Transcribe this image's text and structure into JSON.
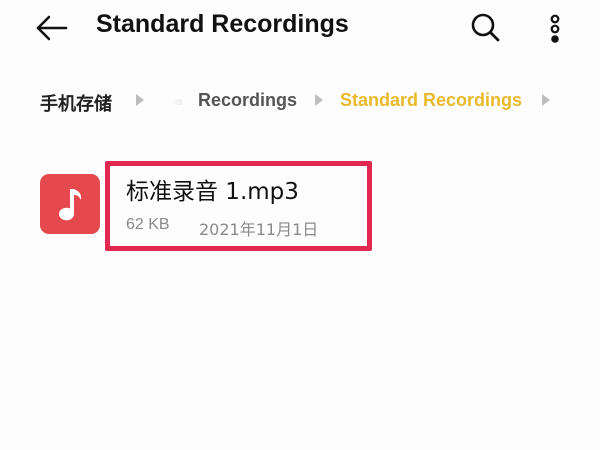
{
  "header": {
    "title": "Standard Recordings",
    "back_icon": "arrow-left-icon",
    "search_icon": "search-icon",
    "more_icon": "more-vertical-icon"
  },
  "breadcrumb": {
    "items": [
      {
        "label": "手机存储"
      },
      {
        "label": "Recordings"
      },
      {
        "label": "Standard Recordings"
      }
    ],
    "current_color": "#e9b92a"
  },
  "files": [
    {
      "name": "标准录音 1.mp3",
      "size": "62 KB",
      "date": "2021年11月1日",
      "icon": "music-note-icon",
      "icon_color": "#e5484d"
    }
  ],
  "highlight_color": "#e2284f"
}
